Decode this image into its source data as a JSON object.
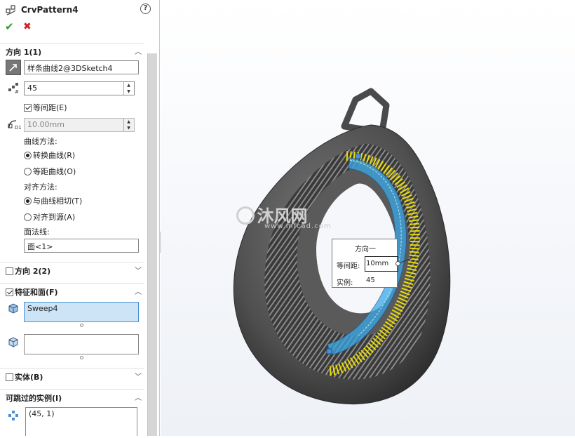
{
  "panel": {
    "title": "CrvPattern4",
    "help": "?",
    "ok": "✔",
    "cancel": "✖",
    "direction1": {
      "title": "方向 1(1)",
      "curve": "样条曲线2@3DSketch4",
      "instances": "45",
      "equal_spacing_label": "等间距(E)",
      "equal_spacing_checked": true,
      "spacing": "10.00mm",
      "curve_method_label": "曲线方法:",
      "curve_method_options": [
        "转换曲线(R)",
        "等距曲线(O)"
      ],
      "curve_method_selected": 0,
      "align_method_label": "对齐方法:",
      "align_method_options": [
        "与曲线相切(T)",
        "对齐到源(A)"
      ],
      "align_method_selected": 0,
      "face_normal_label": "面法线:",
      "face_normal": "面<1>"
    },
    "direction2": {
      "title": "方向 2(2)",
      "checked": false
    },
    "features_faces": {
      "title": "特征和面(F)",
      "checked": true,
      "feature": "Sweep4",
      "faces": ""
    },
    "bodies": {
      "title": "实体(B)",
      "checked": false
    },
    "skip_instances": {
      "title": "可跳过的实例(I)",
      "value": "(45, 1)"
    }
  },
  "callout": {
    "title": "方向一",
    "spacing_label": "等间距:",
    "spacing_value": "10mm",
    "instances_label": "实例:",
    "instances_value": "45"
  },
  "watermark": {
    "brand": "沐风网",
    "url": "www.mfcad.com"
  },
  "colors": {
    "accent": "#4a90d6",
    "ok": "#2e9a2e",
    "cancel": "#d22020",
    "highlight": "#f2e400"
  }
}
